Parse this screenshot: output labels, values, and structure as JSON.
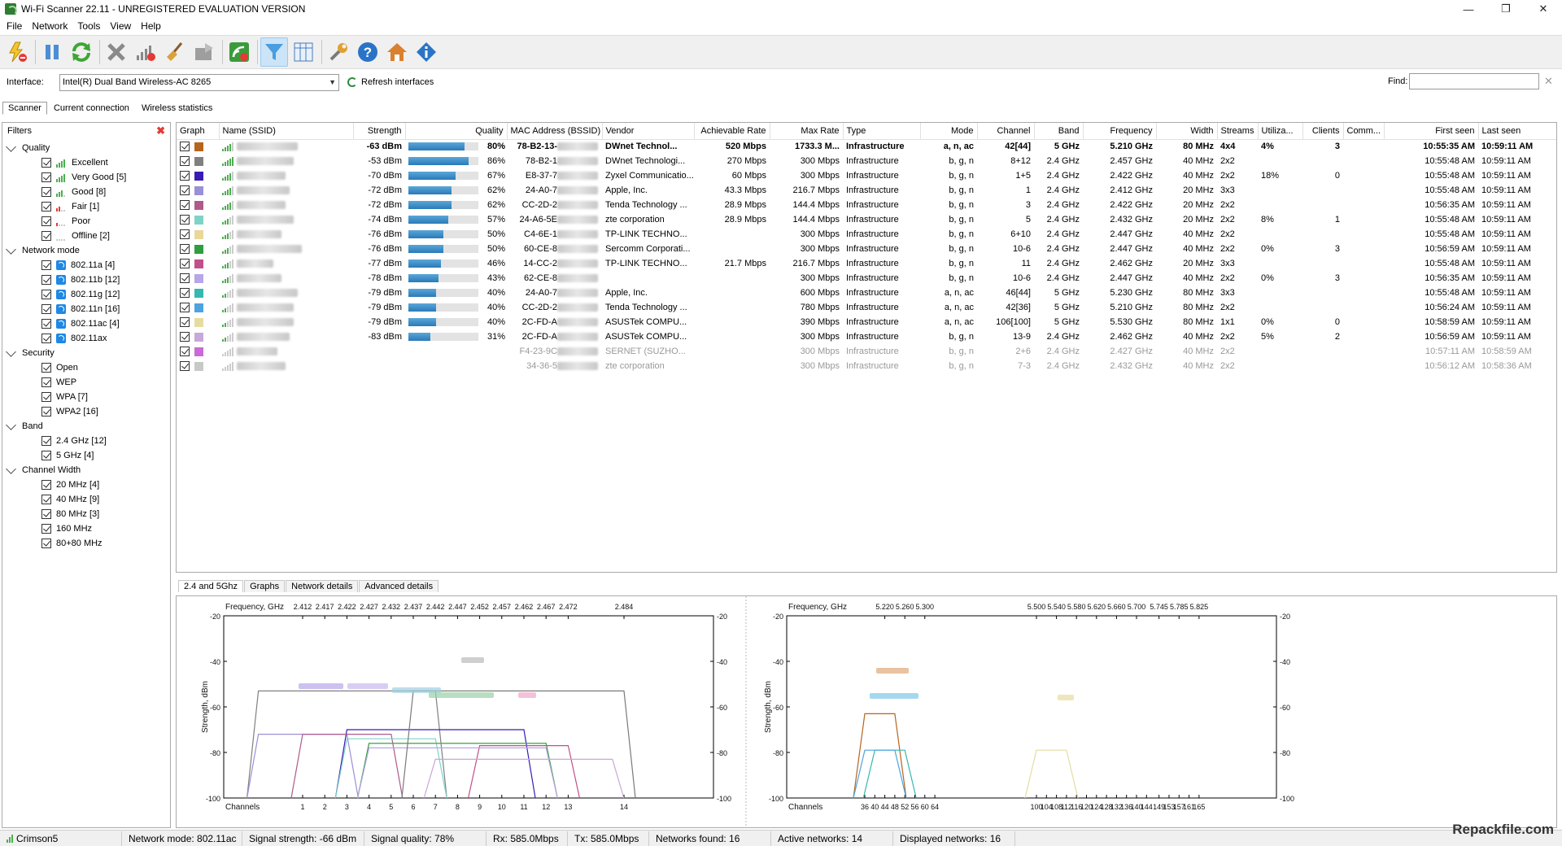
{
  "window": {
    "title": "Wi-Fi Scanner 22.11 - UNREGISTERED EVALUATION VERSION",
    "minimize": "—",
    "maximize": "❐",
    "close": "✕"
  },
  "menu": [
    "File",
    "Network",
    "Tools",
    "View",
    "Help"
  ],
  "toolbar": {
    "icons": [
      "lightning-stop-icon",
      "pause-icon",
      "refresh-icon",
      "clear-icon",
      "signal-stop-icon",
      "broom-icon",
      "export-icon",
      "monitor-icon",
      "filter-icon",
      "columns-icon",
      "wrench-icon",
      "help-icon",
      "home-icon",
      "info-icon"
    ]
  },
  "interface": {
    "label": "Interface:",
    "selected": "Intel(R) Dual Band Wireless-AC 8265",
    "refresh_label": "Refresh interfaces",
    "find_label": "Find:"
  },
  "tabs_top": [
    "Scanner",
    "Current connection",
    "Wireless statistics"
  ],
  "filters": {
    "title": "Filters",
    "groups": [
      {
        "name": "Quality",
        "items": [
          "Excellent",
          "Very Good [5]",
          "Good [8]",
          "Fair [1]",
          "Poor",
          "Offline [2]"
        ]
      },
      {
        "name": "Network mode",
        "items": [
          "802.11a [4]",
          "802.11b [12]",
          "802.11g [12]",
          "802.11n [16]",
          "802.11ac [4]",
          "802.11ax"
        ]
      },
      {
        "name": "Security",
        "items": [
          "Open",
          "WEP",
          "WPA [7]",
          "WPA2 [16]"
        ]
      },
      {
        "name": "Band",
        "items": [
          "2.4 GHz [12]",
          "5 GHz [4]"
        ]
      },
      {
        "name": "Channel Width",
        "items": [
          "20 MHz [4]",
          "40 MHz [9]",
          "80 MHz [3]",
          "160 MHz",
          "80+80 MHz"
        ]
      }
    ]
  },
  "table": {
    "columns": [
      "Graph",
      "Name (SSID)",
      "Strength",
      "Quality",
      "MAC Address (BSSID)",
      "Vendor",
      "Achievable Rate",
      "Max Rate",
      "Type",
      "Mode",
      "Channel",
      "Band",
      "Frequency",
      "Width",
      "Streams",
      "Utiliza...",
      "Clients",
      "Comm...",
      "First seen",
      "Last seen"
    ],
    "rows": [
      {
        "color": "#b5651d",
        "strength": "-63 dBm",
        "quality": "80%",
        "q": 0.8,
        "mac": "78-B2-13-",
        "vendor": "DWnet Technol...",
        "achievable": "520 Mbps",
        "max": "1733.3 M...",
        "type": "Infrastructure",
        "mode": "a, n, ac",
        "channel": "42[44]",
        "band": "5 GHz",
        "freq": "5.210 GHz",
        "width": "80 MHz",
        "streams": "4x4",
        "util": "4%",
        "clients": "3",
        "first": "10:55:35 AM",
        "last": "10:59:11 AM",
        "style": "bold"
      },
      {
        "color": "#808080",
        "strength": "-53 dBm",
        "quality": "86%",
        "q": 0.86,
        "mac": "78-B2-1",
        "vendor": "DWnet Technologi...",
        "achievable": "270 Mbps",
        "max": "300 Mbps",
        "type": "Infrastructure",
        "mode": "b, g, n",
        "channel": "8+12",
        "band": "2.4 GHz",
        "freq": "2.457 GHz",
        "width": "40 MHz",
        "streams": "2x2",
        "util": "",
        "clients": "",
        "first": "10:55:48 AM",
        "last": "10:59:11 AM",
        "style": ""
      },
      {
        "color": "#3a1bb5",
        "strength": "-70 dBm",
        "quality": "67%",
        "q": 0.67,
        "mac": "E8-37-7",
        "vendor": "Zyxel Communicatio...",
        "achievable": "60 Mbps",
        "max": "300 Mbps",
        "type": "Infrastructure",
        "mode": "b, g, n",
        "channel": "1+5",
        "band": "2.4 GHz",
        "freq": "2.422 GHz",
        "width": "40 MHz",
        "streams": "2x2",
        "util": "18%",
        "clients": "0",
        "first": "10:55:48 AM",
        "last": "10:59:11 AM",
        "style": ""
      },
      {
        "color": "#9b8fd6",
        "strength": "-72 dBm",
        "quality": "62%",
        "q": 0.62,
        "mac": "24-A0-7",
        "vendor": "Apple, Inc.",
        "achievable": "43.3 Mbps",
        "max": "216.7 Mbps",
        "type": "Infrastructure",
        "mode": "b, g, n",
        "channel": "1",
        "band": "2.4 GHz",
        "freq": "2.412 GHz",
        "width": "20 MHz",
        "streams": "3x3",
        "util": "",
        "clients": "",
        "first": "10:55:48 AM",
        "last": "10:59:11 AM",
        "style": ""
      },
      {
        "color": "#b05a8a",
        "strength": "-72 dBm",
        "quality": "62%",
        "q": 0.62,
        "mac": "CC-2D-2",
        "vendor": "Tenda Technology ...",
        "achievable": "28.9 Mbps",
        "max": "144.4 Mbps",
        "type": "Infrastructure",
        "mode": "b, g, n",
        "channel": "3",
        "band": "2.4 GHz",
        "freq": "2.422 GHz",
        "width": "20 MHz",
        "streams": "2x2",
        "util": "",
        "clients": "",
        "first": "10:56:35 AM",
        "last": "10:59:11 AM",
        "style": ""
      },
      {
        "color": "#7ed3c9",
        "strength": "-74 dBm",
        "quality": "57%",
        "q": 0.57,
        "mac": "24-A6-5E",
        "vendor": "zte corporation",
        "achievable": "28.9 Mbps",
        "max": "144.4 Mbps",
        "type": "Infrastructure",
        "mode": "b, g, n",
        "channel": "5",
        "band": "2.4 GHz",
        "freq": "2.432 GHz",
        "width": "20 MHz",
        "streams": "2x2",
        "util": "8%",
        "clients": "1",
        "first": "10:55:48 AM",
        "last": "10:59:11 AM",
        "style": ""
      },
      {
        "color": "#e8d89a",
        "strength": "-76 dBm",
        "quality": "50%",
        "q": 0.5,
        "mac": "C4-6E-1",
        "vendor": "TP-LINK TECHNO...",
        "achievable": "",
        "max": "300 Mbps",
        "type": "Infrastructure",
        "mode": "b, g, n",
        "channel": "6+10",
        "band": "2.4 GHz",
        "freq": "2.447 GHz",
        "width": "40 MHz",
        "streams": "2x2",
        "util": "",
        "clients": "",
        "first": "10:55:48 AM",
        "last": "10:59:11 AM",
        "style": ""
      },
      {
        "color": "#2e9e3e",
        "strength": "-76 dBm",
        "quality": "50%",
        "q": 0.5,
        "mac": "60-CE-8",
        "vendor": "Sercomm Corporati...",
        "achievable": "",
        "max": "300 Mbps",
        "type": "Infrastructure",
        "mode": "b, g, n",
        "channel": "10-6",
        "band": "2.4 GHz",
        "freq": "2.447 GHz",
        "width": "40 MHz",
        "streams": "2x2",
        "util": "0%",
        "clients": "3",
        "first": "10:56:59 AM",
        "last": "10:59:11 AM",
        "style": ""
      },
      {
        "color": "#c0508a",
        "strength": "-77 dBm",
        "quality": "46%",
        "q": 0.46,
        "mac": "14-CC-2",
        "vendor": "TP-LINK TECHNO...",
        "achievable": "21.7 Mbps",
        "max": "216.7 Mbps",
        "type": "Infrastructure",
        "mode": "b, g, n",
        "channel": "11",
        "band": "2.4 GHz",
        "freq": "2.462 GHz",
        "width": "20 MHz",
        "streams": "3x3",
        "util": "",
        "clients": "",
        "first": "10:55:48 AM",
        "last": "10:59:11 AM",
        "style": ""
      },
      {
        "color": "#b7a6e8",
        "strength": "-78 dBm",
        "quality": "43%",
        "q": 0.43,
        "mac": "62-CE-8",
        "vendor": "",
        "achievable": "",
        "max": "300 Mbps",
        "type": "Infrastructure",
        "mode": "b, g, n",
        "channel": "10-6",
        "band": "2.4 GHz",
        "freq": "2.447 GHz",
        "width": "40 MHz",
        "streams": "2x2",
        "util": "0%",
        "clients": "3",
        "first": "10:56:35 AM",
        "last": "10:59:11 AM",
        "style": ""
      },
      {
        "color": "#34b8b0",
        "strength": "-79 dBm",
        "quality": "40%",
        "q": 0.4,
        "mac": "24-A0-7",
        "vendor": "Apple, Inc.",
        "achievable": "",
        "max": "600 Mbps",
        "type": "Infrastructure",
        "mode": "a, n, ac",
        "channel": "46[44]",
        "band": "5 GHz",
        "freq": "5.230 GHz",
        "width": "80 MHz",
        "streams": "3x3",
        "util": "",
        "clients": "",
        "first": "10:55:48 AM",
        "last": "10:59:11 AM",
        "style": ""
      },
      {
        "color": "#4ca3e0",
        "strength": "-79 dBm",
        "quality": "40%",
        "q": 0.4,
        "mac": "CC-2D-2",
        "vendor": "Tenda Technology ...",
        "achievable": "",
        "max": "780 Mbps",
        "type": "Infrastructure",
        "mode": "a, n, ac",
        "channel": "42[36]",
        "band": "5 GHz",
        "freq": "5.210 GHz",
        "width": "80 MHz",
        "streams": "2x2",
        "util": "",
        "clients": "",
        "first": "10:56:24 AM",
        "last": "10:59:11 AM",
        "style": ""
      },
      {
        "color": "#e6dca0",
        "strength": "-79 dBm",
        "quality": "40%",
        "q": 0.4,
        "mac": "2C-FD-A",
        "vendor": "ASUSTek COMPU...",
        "achievable": "",
        "max": "390 Mbps",
        "type": "Infrastructure",
        "mode": "a, n, ac",
        "channel": "106[100]",
        "band": "5 GHz",
        "freq": "5.530 GHz",
        "width": "80 MHz",
        "streams": "1x1",
        "util": "0%",
        "clients": "0",
        "first": "10:58:59 AM",
        "last": "10:59:11 AM",
        "style": ""
      },
      {
        "color": "#c8a8d8",
        "strength": "-83 dBm",
        "quality": "31%",
        "q": 0.31,
        "mac": "2C-FD-A",
        "vendor": "ASUSTek COMPU...",
        "achievable": "",
        "max": "300 Mbps",
        "type": "Infrastructure",
        "mode": "b, g, n",
        "channel": "13-9",
        "band": "2.4 GHz",
        "freq": "2.462 GHz",
        "width": "40 MHz",
        "streams": "2x2",
        "util": "5%",
        "clients": "2",
        "first": "10:56:59 AM",
        "last": "10:59:11 AM",
        "style": ""
      },
      {
        "color": "#c96ad8",
        "strength": "",
        "quality": "",
        "q": 0,
        "mac": "F4-23-9C",
        "vendor": "SERNET (SUZHO...",
        "achievable": "",
        "max": "300 Mbps",
        "type": "Infrastructure",
        "mode": "b, g, n",
        "channel": "2+6",
        "band": "2.4 GHz",
        "freq": "2.427 GHz",
        "width": "40 MHz",
        "streams": "2x2",
        "util": "",
        "clients": "",
        "first": "10:57:11 AM",
        "last": "10:58:59 AM",
        "style": "grey"
      },
      {
        "color": "#c8c8c8",
        "strength": "",
        "quality": "",
        "q": 0,
        "mac": "34-36-5",
        "vendor": "zte corporation",
        "achievable": "",
        "max": "300 Mbps",
        "type": "Infrastructure",
        "mode": "b, g, n",
        "channel": "7-3",
        "band": "2.4 GHz",
        "freq": "2.432 GHz",
        "width": "40 MHz",
        "streams": "2x2",
        "util": "",
        "clients": "",
        "first": "10:56:12 AM",
        "last": "10:58:36 AM",
        "style": "grey"
      }
    ]
  },
  "bottom_tabs": [
    "2.4 and 5Ghz",
    "Graphs",
    "Network details",
    "Advanced details"
  ],
  "chart_left": {
    "freq_label": "Frequency, GHz",
    "freqs": [
      "2.412",
      "2.417",
      "2.422",
      "2.427",
      "2.432",
      "2.437",
      "2.442",
      "2.447",
      "2.452",
      "2.457",
      "2.462",
      "2.467",
      "2.472",
      "2.484"
    ],
    "channels_label": "Channels",
    "channels": [
      "1",
      "2",
      "3",
      "4",
      "5",
      "6",
      "7",
      "8",
      "9",
      "10",
      "11",
      "12",
      "13",
      "14"
    ],
    "y_label": "Strength, dBm",
    "y_ticks": [
      "-20",
      "-40",
      "-60",
      "-80",
      "-100"
    ]
  },
  "chart_right": {
    "freq_label": "Frequency, GHz",
    "freqs": [
      "5.220",
      "5.260",
      "5.300",
      "5.500",
      "5.540",
      "5.580",
      "5.620",
      "5.660",
      "5.700",
      "5.745",
      "5.785",
      "5.825"
    ],
    "channels_label": "Channels",
    "channels": [
      "36",
      "40",
      "44",
      "48",
      "52",
      "56",
      "60",
      "64",
      "100",
      "104",
      "108",
      "112",
      "116",
      "120",
      "124",
      "128",
      "132",
      "136",
      "140",
      "144",
      "149",
      "153",
      "157",
      "161",
      "165"
    ],
    "y_label": "Strength, dBm",
    "y_ticks": [
      "-20",
      "-40",
      "-60",
      "-80",
      "-100"
    ]
  },
  "status": {
    "ssid": "Crimson5",
    "mode": "Network mode: 802.11ac",
    "strength": "Signal strength: -66 dBm",
    "quality": "Signal quality: 78%",
    "rx": "Rx: 585.0Mbps",
    "tx": "Tx: 585.0Mbps",
    "found": "Networks found: 16",
    "active": "Active networks: 14",
    "displayed": "Displayed networks: 16"
  },
  "watermark": "Repackfile.com"
}
